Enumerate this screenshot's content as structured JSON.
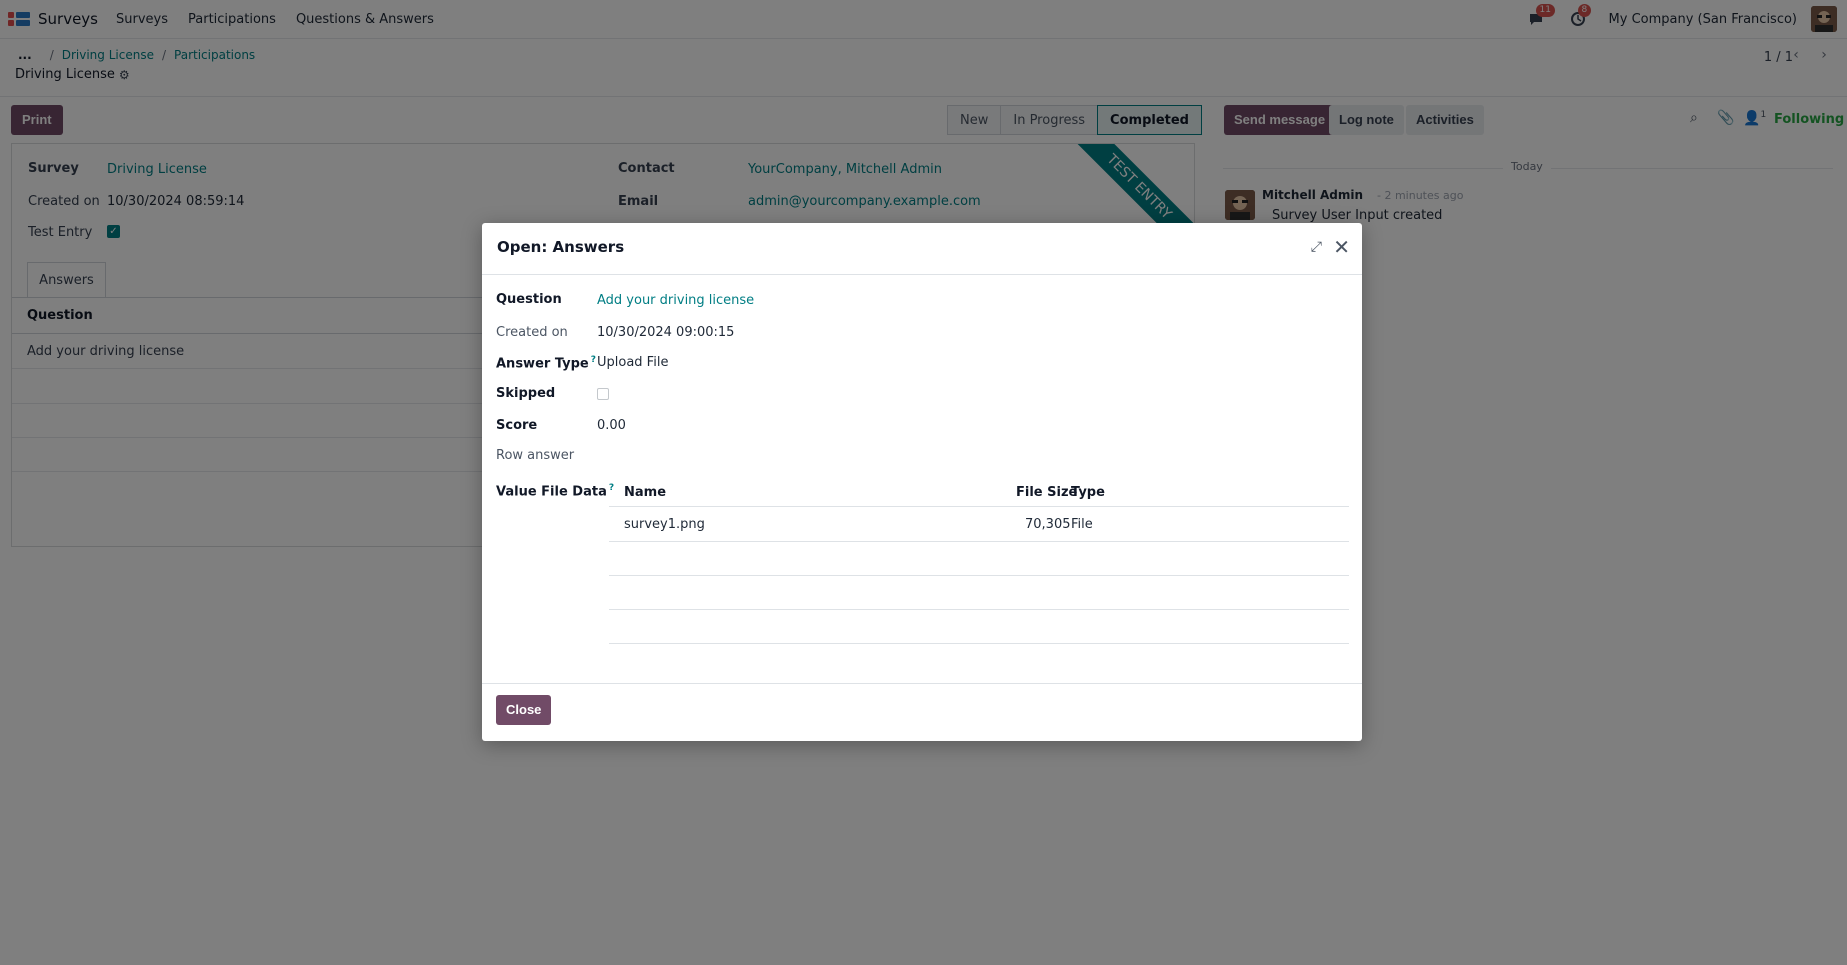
{
  "navbar": {
    "app_name": "Surveys",
    "menu": [
      "Surveys",
      "Participations",
      "Questions & Answers"
    ],
    "messages_count": "11",
    "activities_count": "8",
    "company": "My Company (San Francisco)"
  },
  "breadcrumb": {
    "ellipsis": "...",
    "items": [
      "Driving License",
      "Participations"
    ],
    "current": "Driving License"
  },
  "pager": {
    "text": "1 / 1"
  },
  "actions": {
    "print": "Print"
  },
  "statusbar": {
    "stages": [
      "New",
      "In Progress",
      "Completed"
    ],
    "active": "Completed"
  },
  "ribbon": "TEST ENTRY",
  "form": {
    "survey_label": "Survey",
    "survey_value": "Driving License",
    "created_label": "Created on",
    "created_value": "10/30/2024 08:59:14",
    "test_entry_label": "Test Entry",
    "contact_label": "Contact",
    "contact_value": "YourCompany, Mitchell Admin",
    "email_label": "Email",
    "email_value": "admin@yourcompany.example.com",
    "tab": "Answers",
    "list_header": "Question",
    "rows": [
      "Add your driving license"
    ]
  },
  "chatter": {
    "send_message": "Send message",
    "log_note": "Log note",
    "activities": "Activities",
    "followers_count": "1",
    "following": "Following",
    "date_separator": "Today",
    "author": "Mitchell Admin",
    "time": "- 2 minutes ago",
    "body": "Survey User Input created"
  },
  "modal": {
    "title": "Open: Answers",
    "question_label": "Question",
    "question_value": "Add your driving license",
    "created_label": "Created on",
    "created_value": "10/30/2024 09:00:15",
    "answer_type_label": "Answer Type",
    "answer_type_value": "Upload File",
    "skipped_label": "Skipped",
    "score_label": "Score",
    "score_value": "0.00",
    "row_answer_label": "Row answer",
    "file_data_label": "Value File Data",
    "help_mark": "?",
    "table": {
      "headers": {
        "name": "Name",
        "size": "File Size",
        "type": "Type"
      },
      "rows": [
        {
          "name": "survey1.png",
          "size": "70,305",
          "type": "File"
        }
      ]
    },
    "close": "Close"
  },
  "colors": {
    "brand": "#714b67",
    "link": "#017e84",
    "badge": "#d9534f",
    "following": "#28a745"
  }
}
